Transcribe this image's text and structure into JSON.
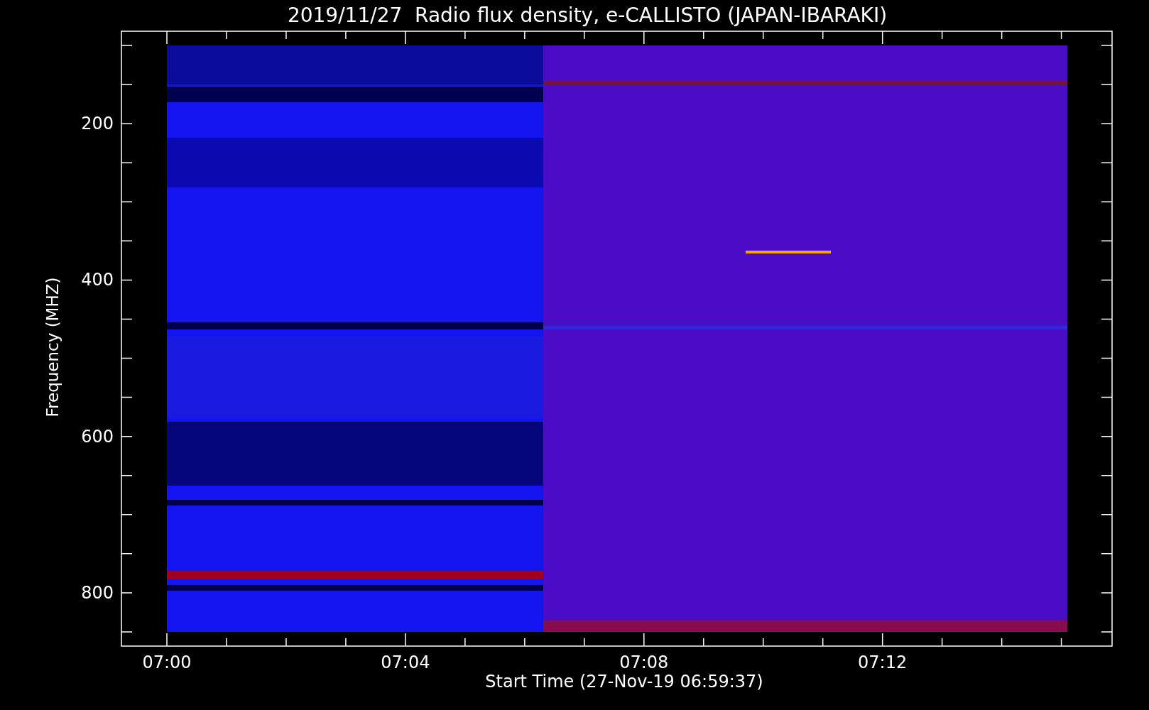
{
  "title": "2019/11/27  Radio flux density, e-CALLISTO (JAPAN-IBARAKI)",
  "y_axis": {
    "label": "Frequency (MHZ)",
    "ticks": [
      "200",
      "400",
      "600",
      "800"
    ]
  },
  "x_axis": {
    "label": "Start Time (27-Nov-19 06:59:37)",
    "ticks": [
      "07:00",
      "07:04",
      "07:08",
      "07:12"
    ]
  }
}
